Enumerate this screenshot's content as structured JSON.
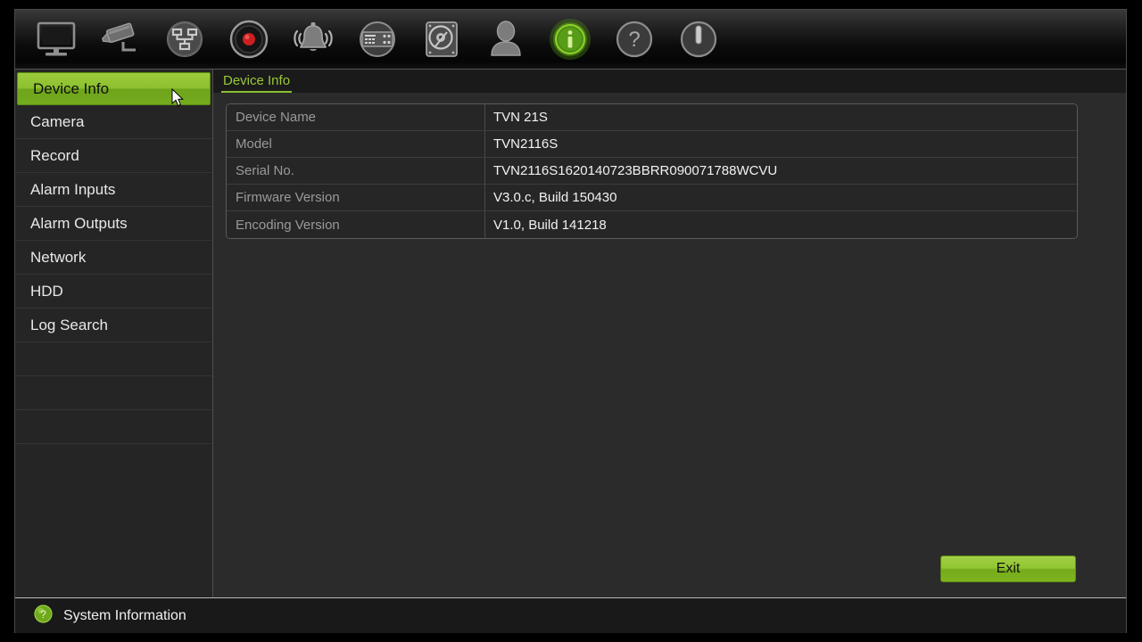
{
  "toolbar": {
    "items": [
      {
        "name": "display-icon",
        "label": "Display"
      },
      {
        "name": "camera-icon",
        "label": "Camera"
      },
      {
        "name": "network-icon",
        "label": "Network"
      },
      {
        "name": "record-icon",
        "label": "Record"
      },
      {
        "name": "alarm-bell-icon",
        "label": "Alarm"
      },
      {
        "name": "device-panel-icon",
        "label": "Device Management"
      },
      {
        "name": "hdd-icon",
        "label": "HDD"
      },
      {
        "name": "user-icon",
        "label": "User"
      },
      {
        "name": "info-icon",
        "label": "System Information"
      },
      {
        "name": "help-icon",
        "label": "Help"
      },
      {
        "name": "power-icon",
        "label": "Shutdown"
      }
    ],
    "active_index": 8
  },
  "sidebar": {
    "items": [
      {
        "label": "Device Info",
        "name": "sidebar-item-device-info",
        "active": true
      },
      {
        "label": "Camera",
        "name": "sidebar-item-camera",
        "active": false
      },
      {
        "label": "Record",
        "name": "sidebar-item-record",
        "active": false
      },
      {
        "label": "Alarm Inputs",
        "name": "sidebar-item-alarm-inputs",
        "active": false
      },
      {
        "label": "Alarm Outputs",
        "name": "sidebar-item-alarm-outputs",
        "active": false
      },
      {
        "label": "Network",
        "name": "sidebar-item-network",
        "active": false
      },
      {
        "label": "HDD",
        "name": "sidebar-item-hdd",
        "active": false
      },
      {
        "label": "Log Search",
        "name": "sidebar-item-log-search",
        "active": false
      }
    ]
  },
  "main": {
    "tab_label": "Device Info",
    "rows": [
      {
        "label": "Device Name",
        "value": "TVN 21S"
      },
      {
        "label": "Model",
        "value": "TVN2116S"
      },
      {
        "label": "Serial No.",
        "value": "TVN2116S1620140723BBRR090071788WCVU"
      },
      {
        "label": "Firmware Version",
        "value": "V3.0.c, Build 150430"
      },
      {
        "label": "Encoding Version",
        "value": "V1.0, Build 141218"
      }
    ],
    "exit_label": "Exit"
  },
  "statusbar": {
    "text": "System Information"
  },
  "colors": {
    "accent_green": "#8cc02e",
    "tab_green": "#9bc93a",
    "record_red": "#cc2020",
    "panel_bg": "#2b2b2b",
    "sidebar_bg": "#252525"
  }
}
